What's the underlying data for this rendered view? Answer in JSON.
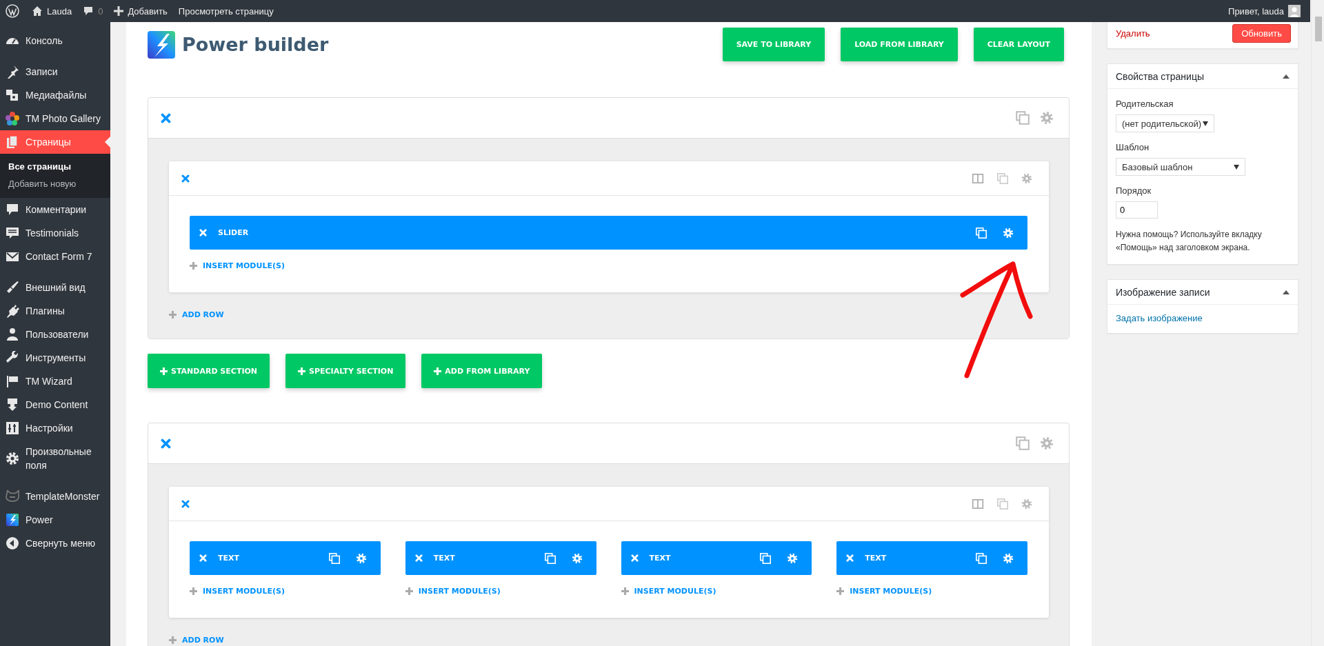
{
  "admin_bar": {
    "site": "Lauda",
    "comments": "0",
    "add_new": "Добавить",
    "view_page": "Просмотреть страницу",
    "greeting": "Привет, lauda"
  },
  "sidebar": {
    "groups": [
      [
        {
          "label": "Консоль",
          "selected": false
        }
      ],
      [
        {
          "label": "Записи",
          "selected": false
        },
        {
          "label": "Медиафайлы",
          "selected": false
        },
        {
          "label": "TM Photo Gallery",
          "selected": false
        },
        {
          "label": "Страницы",
          "selected": true,
          "children": [
            {
              "label": "Все страницы",
              "selected": true
            },
            {
              "label": "Добавить новую",
              "selected": false
            }
          ]
        },
        {
          "label": "Комментарии",
          "selected": false
        },
        {
          "label": "Testimonials",
          "selected": false
        },
        {
          "label": "Contact Form 7",
          "selected": false
        }
      ],
      [
        {
          "label": "Внешний вид",
          "selected": false
        },
        {
          "label": "Плагины",
          "selected": false
        },
        {
          "label": "Пользователи",
          "selected": false
        },
        {
          "label": "Инструменты",
          "selected": false
        },
        {
          "label": "TM Wizard",
          "selected": false
        },
        {
          "label": "Demo Content",
          "selected": false
        },
        {
          "label": "Настройки",
          "selected": false
        },
        {
          "label": "Произвольные поля",
          "selected": false
        }
      ],
      [
        {
          "label": "TemplateMonster",
          "selected": false
        },
        {
          "label": "Power",
          "selected": false
        },
        {
          "label": "Свернуть меню",
          "selected": false
        }
      ]
    ]
  },
  "builder": {
    "title": "Power builder",
    "header_buttons": [
      "SAVE TO LIBRARY",
      "LOAD FROM LIBRARY",
      "CLEAR LAYOUT"
    ],
    "sections": [
      {
        "rows": [
          {
            "columns": [
              {
                "modules": [
                  {
                    "label": "SLIDER"
                  }
                ],
                "insert_label": "INSERT MODULE(S)"
              }
            ]
          }
        ],
        "add_row_label": "ADD ROW"
      },
      {
        "rows": [
          {
            "columns": [
              {
                "modules": [
                  {
                    "label": "TEXT"
                  }
                ],
                "insert_label": "INSERT MODULE(S)"
              },
              {
                "modules": [
                  {
                    "label": "TEXT"
                  }
                ],
                "insert_label": "INSERT MODULE(S)"
              },
              {
                "modules": [
                  {
                    "label": "TEXT"
                  }
                ],
                "insert_label": "INSERT MODULE(S)"
              },
              {
                "modules": [
                  {
                    "label": "TEXT"
                  }
                ],
                "insert_label": "INSERT MODULE(S)"
              }
            ]
          }
        ],
        "add_row_label": "ADD ROW"
      }
    ],
    "section_buttons": [
      "STANDARD SECTION",
      "SPECIALTY SECTION",
      "ADD FROM LIBRARY"
    ]
  },
  "publish_box": {
    "delete_link": "Удалить",
    "update_button": "Обновить"
  },
  "page_attributes": {
    "title": "Свойства страницы",
    "parent_label": "Родительская",
    "parent_value": "(нет родительской)",
    "template_label": "Шаблон",
    "template_value": "Базовый шаблон",
    "order_label": "Порядок",
    "order_value": "0",
    "help_text": "Нужна помощь? Используйте вкладку «Помощь» над заголовком экрана."
  },
  "featured_image": {
    "title": "Изображение записи",
    "link": "Задать изображение"
  }
}
